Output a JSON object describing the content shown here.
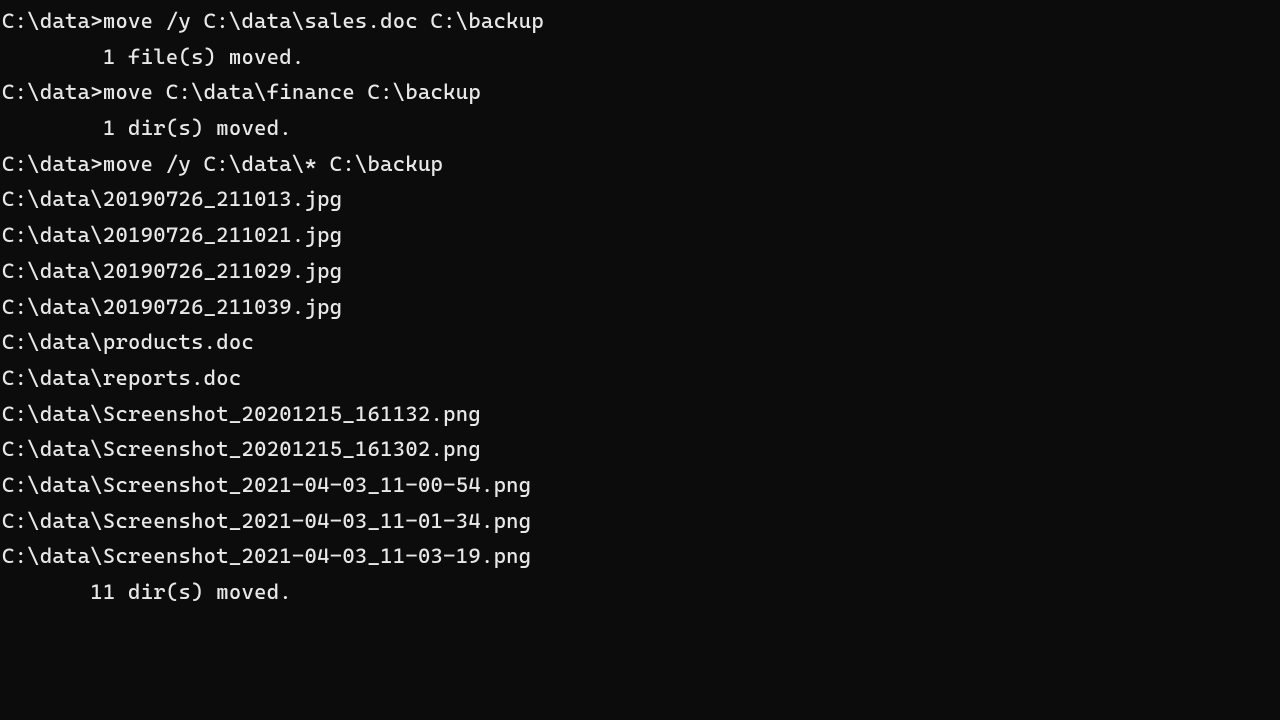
{
  "terminal": {
    "lines": [
      {
        "text": "C:\\data>move /y C:\\data\\sales.doc C:\\backup"
      },
      {
        "text": "        1 file(s) moved."
      },
      {
        "text": ""
      },
      {
        "text": "C:\\data>move C:\\data\\finance C:\\backup"
      },
      {
        "text": "        1 dir(s) moved."
      },
      {
        "text": ""
      },
      {
        "text": "C:\\data>move /y C:\\data\\* C:\\backup"
      },
      {
        "text": "C:\\data\\20190726_211013.jpg"
      },
      {
        "text": "C:\\data\\20190726_211021.jpg"
      },
      {
        "text": "C:\\data\\20190726_211029.jpg"
      },
      {
        "text": "C:\\data\\20190726_211039.jpg"
      },
      {
        "text": "C:\\data\\products.doc"
      },
      {
        "text": "C:\\data\\reports.doc"
      },
      {
        "text": "C:\\data\\Screenshot_20201215_161132.png"
      },
      {
        "text": "C:\\data\\Screenshot_20201215_161302.png"
      },
      {
        "text": "C:\\data\\Screenshot_2021-04-03_11-00-54.png"
      },
      {
        "text": "C:\\data\\Screenshot_2021-04-03_11-01-34.png"
      },
      {
        "text": "C:\\data\\Screenshot_2021-04-03_11-03-19.png"
      },
      {
        "text": "       11 dir(s) moved."
      }
    ]
  }
}
